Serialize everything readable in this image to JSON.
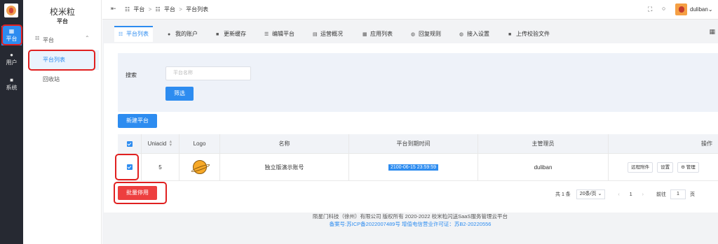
{
  "rail": {
    "items": [
      {
        "icon": "apps-icon",
        "glyph": "▦",
        "label": "平台",
        "active": true
      },
      {
        "icon": "user-icon",
        "glyph": "●",
        "label": "用户",
        "active": false
      },
      {
        "icon": "windows-icon",
        "glyph": "■",
        "label": "系统",
        "active": false
      }
    ]
  },
  "sidebar": {
    "title": "校米粒",
    "subtitle": "平台",
    "group_label": "平台",
    "items": [
      {
        "label": "平台列表",
        "active": true
      },
      {
        "label": "回收站",
        "active": false
      }
    ]
  },
  "header": {
    "breadcrumbs": [
      "平台",
      "平台",
      "平台列表"
    ],
    "username": "duliban"
  },
  "tabs": [
    {
      "label": "平台列表",
      "icon": "grid-icon",
      "active": true
    },
    {
      "label": "我的账户",
      "icon": "user-icon",
      "active": false
    },
    {
      "label": "更新缓存",
      "icon": "windows-icon",
      "active": false
    },
    {
      "label": "编辑平台",
      "icon": "list-icon",
      "active": false
    },
    {
      "label": "运营概况",
      "icon": "chart-icon",
      "active": false
    },
    {
      "label": "应用列表",
      "icon": "apps-icon",
      "active": false
    },
    {
      "label": "回复规则",
      "icon": "chat-icon",
      "active": false
    },
    {
      "label": "接入设置",
      "icon": "chat-icon",
      "active": false
    },
    {
      "label": "上传校验文件",
      "icon": "windows-icon",
      "active": false
    }
  ],
  "filter": {
    "label": "搜索",
    "placeholder": "平台名称",
    "submit": "筛选"
  },
  "new_button": "新建平台",
  "table": {
    "headers": [
      "",
      "Uniacid",
      "Logo",
      "名称",
      "平台到期时间",
      "主管理员",
      "操作"
    ],
    "rows": [
      {
        "uniacid": "5",
        "name": "独立版演示账号",
        "expire": "2100-06-15 23:59:59",
        "admin": "duliban",
        "actions": [
          "远程附件",
          "设置",
          "⚙ 管理"
        ]
      }
    ]
  },
  "batch_button": "批量停用",
  "pager": {
    "total": "共 1 条",
    "size": "20条/页",
    "page": "1",
    "jump_label": "前往",
    "jump_value": "1",
    "jump_suffix": "页"
  },
  "footer": {
    "line1": "陨星门科技（徐州）有限公司 版权所有 2020-2022 校米粒闪送SaaS服务管理云平台",
    "line2": "备案号:苏ICP备2022007489号 增值电信营业许可证：苏B2-20220556"
  },
  "colors": {
    "primary": "#2d8cf0",
    "danger": "#ed3f3f",
    "rail_bg": "#262932",
    "highlight_ring": "#e02020"
  }
}
